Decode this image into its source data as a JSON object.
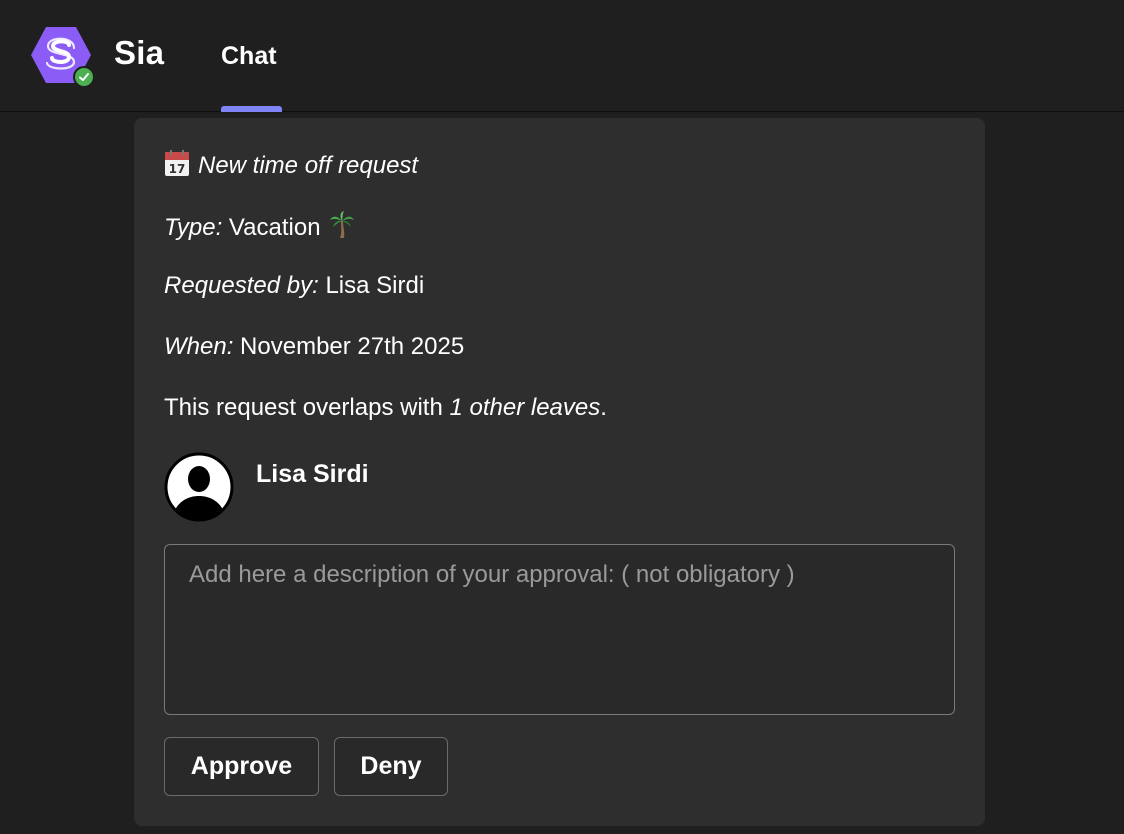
{
  "header": {
    "app_name": "Sia",
    "tabs": [
      {
        "label": "Chat",
        "active": true
      }
    ],
    "accent_color": "#7f85f5",
    "logo_color": "#8b5cf6",
    "status_color": "#4caf50"
  },
  "card": {
    "title_icon": "calendar-icon",
    "title": "New time off request",
    "type_label": "Type:",
    "type_value": "Vacation",
    "type_icon": "palm-tree-icon",
    "requested_by_label": "Requested by:",
    "requested_by_value": "Lisa Sirdi",
    "when_label": "When:",
    "when_value": "November 27th 2025",
    "overlap_prefix": "This request overlaps with ",
    "overlap_count": "1 other leaves",
    "overlap_suffix": ".",
    "person": {
      "name": "Lisa Sirdi",
      "avatar_icon": "user-silhouette-icon"
    },
    "description": {
      "value": "",
      "placeholder": "Add here a description of your approval: ( not obligatory )"
    },
    "actions": {
      "approve_label": "Approve",
      "deny_label": "Deny"
    }
  }
}
